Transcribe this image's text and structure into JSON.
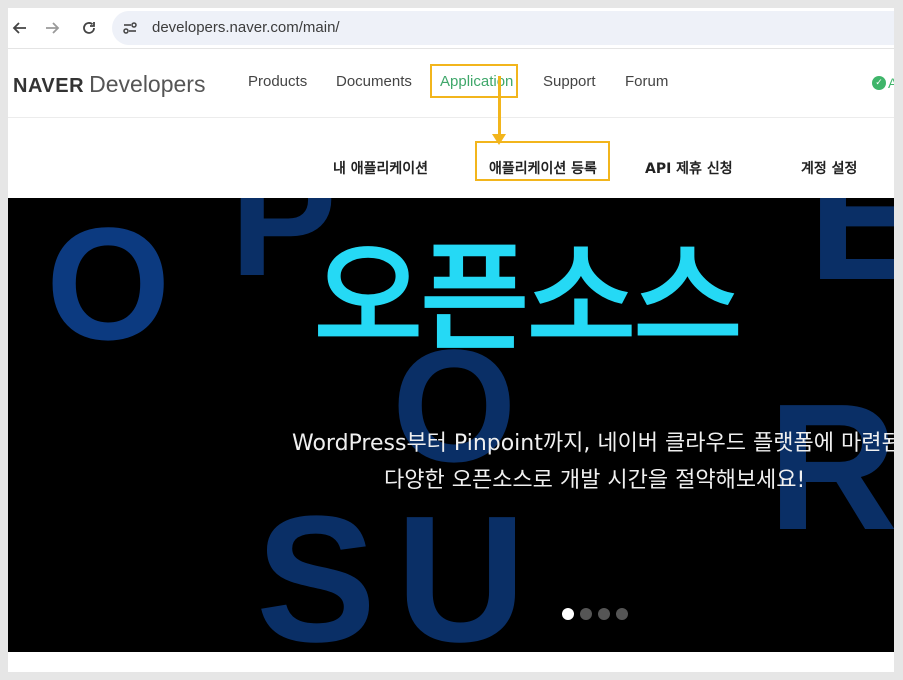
{
  "browser": {
    "url": "developers.naver.com/main/",
    "icons": [
      "back-arrow-icon",
      "forward-arrow-icon",
      "reload-icon",
      "site-info-icon"
    ]
  },
  "header": {
    "logo_brand": "NAVER",
    "logo_product": "Developers",
    "nav": [
      "Products",
      "Documents",
      "Application",
      "Support",
      "Forum"
    ],
    "active_nav": "Application",
    "status_text": "A"
  },
  "subnav": {
    "items": [
      "내 애플리케이션",
      "애플리케이션 등록",
      "API 제휴 신청",
      "계정 설정"
    ],
    "highlighted": "애플리케이션 등록"
  },
  "hero": {
    "title": "오픈소스",
    "desc_line1": "WordPress부터 Pinpoint까지, 네이버 클라우드 플랫폼에 마련된",
    "desc_line2": "다양한 오픈소스로 개발 시간을 절약해보세요!",
    "bg_letters": [
      "O",
      "P",
      "O",
      "S",
      "U",
      "R",
      "E"
    ],
    "slide_count": 4,
    "active_slide": 1
  },
  "colors": {
    "highlight": "#f2b51c",
    "active_nav": "#3fa76a",
    "hero_title": "#25d9f5",
    "hero_bg": "#000000",
    "bg_letter": "#0a2f66"
  }
}
